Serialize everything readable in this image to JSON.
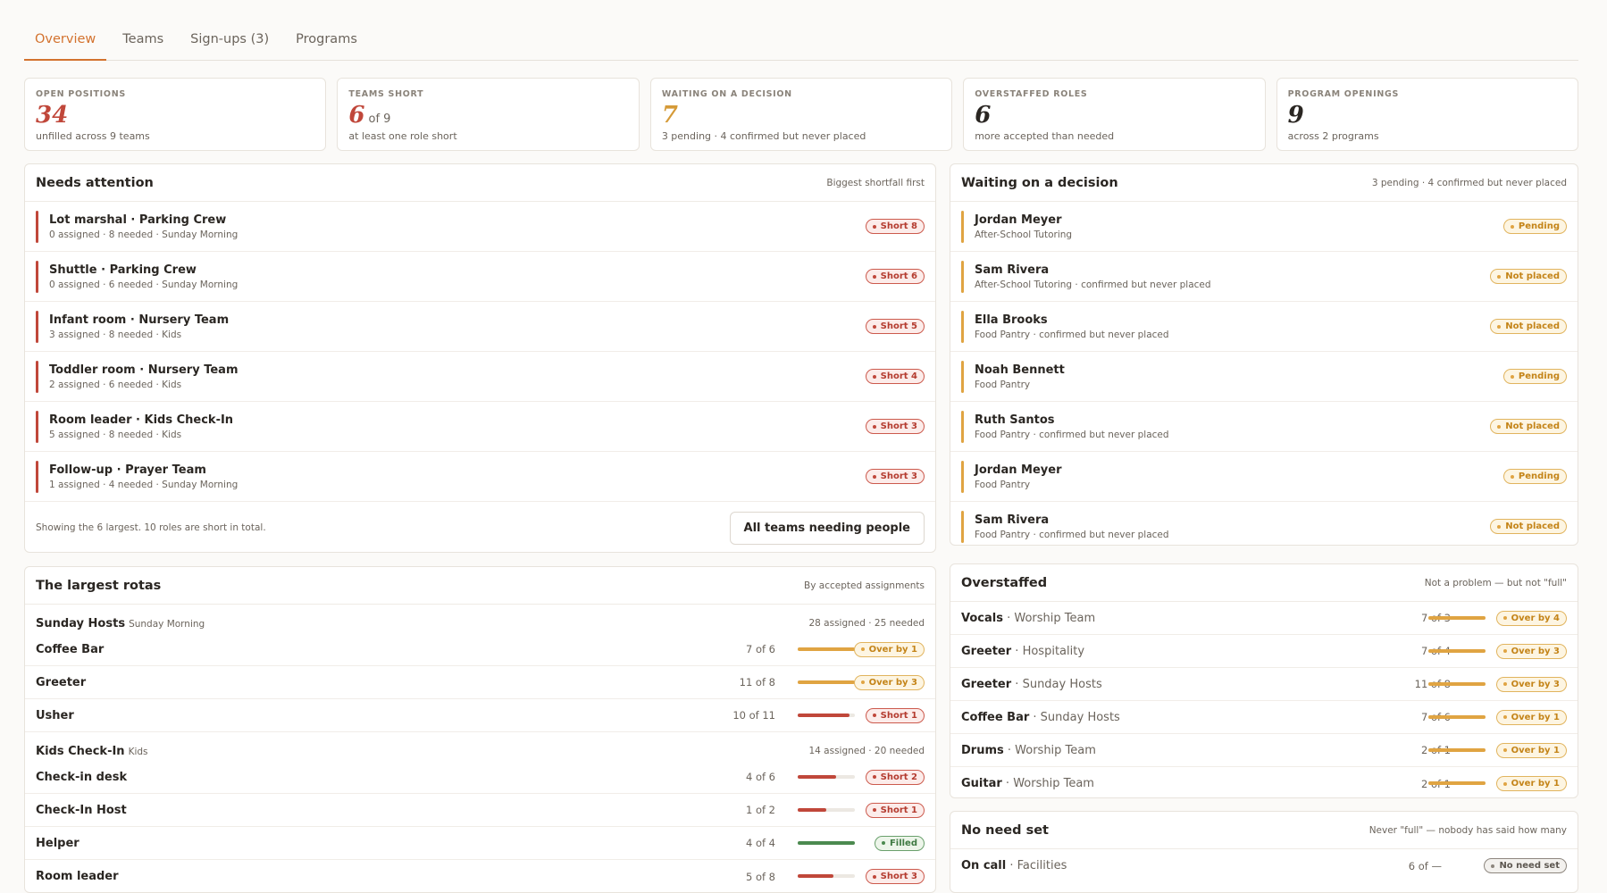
{
  "tabs": [
    {
      "label": "Overview",
      "active": true
    },
    {
      "label": "Teams",
      "active": false
    },
    {
      "label": "Sign-ups (3)",
      "active": false
    },
    {
      "label": "Programs",
      "active": false
    }
  ],
  "stats": [
    {
      "label": "OPEN POSITIONS",
      "value": "34",
      "suffix": "",
      "sub": "unfilled across 9 teams",
      "color": "#c0473a"
    },
    {
      "label": "TEAMS SHORT",
      "value": "6",
      "suffix": "of 9",
      "sub": "at least one role short",
      "color": "#c0473a"
    },
    {
      "label": "WAITING ON A DECISION",
      "value": "7",
      "suffix": "",
      "sub": "3 pending · 4 confirmed but never placed",
      "color": "#d59a37"
    },
    {
      "label": "OVERSTAFFED ROLES",
      "value": "6",
      "suffix": "",
      "sub": "more accepted than needed",
      "color": "#2a2622"
    },
    {
      "label": "PROGRAM OPENINGS",
      "value": "9",
      "suffix": "",
      "sub": "across 2 programs",
      "color": "#2a2622"
    }
  ],
  "attention": {
    "title": "Needs attention",
    "meta": "Biggest shortfall first",
    "rows": [
      {
        "title": "Lot marshal · Parking Crew",
        "sub": "0 assigned · 8 needed · Sunday Morning",
        "pill": "Short 8"
      },
      {
        "title": "Shuttle · Parking Crew",
        "sub": "0 assigned · 6 needed · Sunday Morning",
        "pill": "Short 6"
      },
      {
        "title": "Infant room · Nursery Team",
        "sub": "3 assigned · 8 needed · Kids",
        "pill": "Short 5"
      },
      {
        "title": "Toddler room · Nursery Team",
        "sub": "2 assigned · 6 needed · Kids",
        "pill": "Short 4"
      },
      {
        "title": "Room leader · Kids Check-In",
        "sub": "5 assigned · 8 needed · Kids",
        "pill": "Short 3"
      },
      {
        "title": "Follow-up · Prayer Team",
        "sub": "1 assigned · 4 needed · Sunday Morning",
        "pill": "Short 3"
      }
    ],
    "footer_text": "Showing the 6 largest. 10 roles are short in total.",
    "footer_button": "All teams needing people"
  },
  "waiting": {
    "title": "Waiting on a decision",
    "meta": "3 pending · 4 confirmed but never placed",
    "rows": [
      {
        "name": "Jordan Meyer",
        "sub": "After-School Tutoring",
        "pill": "Pending"
      },
      {
        "name": "Sam Rivera",
        "sub": "After-School Tutoring · confirmed but never placed",
        "pill": "Not placed"
      },
      {
        "name": "Ella Brooks",
        "sub": "Food Pantry · confirmed but never placed",
        "pill": "Not placed"
      },
      {
        "name": "Noah Bennett",
        "sub": "Food Pantry",
        "pill": "Pending"
      },
      {
        "name": "Ruth Santos",
        "sub": "Food Pantry · confirmed but never placed",
        "pill": "Not placed"
      },
      {
        "name": "Jordan Meyer",
        "sub": "Food Pantry",
        "pill": "Pending"
      },
      {
        "name": "Sam Rivera",
        "sub": "Food Pantry · confirmed but never placed",
        "pill": "Not placed"
      }
    ]
  },
  "rotas": {
    "title": "The largest rotas",
    "meta": "By accepted assignments",
    "groups": [
      {
        "name": "Sunday Hosts",
        "sub": "Sunday Morning",
        "meta": "28 assigned · 25 needed",
        "rows": [
          {
            "name": "Coffee Bar",
            "count": "7 of 6",
            "fill": 1.0,
            "status": "amber",
            "pill": "Over by 1"
          },
          {
            "name": "Greeter",
            "count": "11 of 8",
            "fill": 1.0,
            "status": "amber",
            "pill": "Over by 3"
          },
          {
            "name": "Usher",
            "count": "10 of 11",
            "fill": 0.91,
            "status": "red",
            "pill": "Short 1"
          }
        ]
      },
      {
        "name": "Kids Check-In",
        "sub": "Kids",
        "meta": "14 assigned · 20 needed",
        "rows": [
          {
            "name": "Check-in desk",
            "count": "4 of 6",
            "fill": 0.67,
            "status": "red",
            "pill": "Short 2"
          },
          {
            "name": "Check-In Host",
            "count": "1 of 2",
            "fill": 0.5,
            "status": "red",
            "pill": "Short 1"
          },
          {
            "name": "Helper",
            "count": "4 of 4",
            "fill": 1.0,
            "status": "green",
            "pill": "Filled"
          },
          {
            "name": "Room leader",
            "count": "5 of 8",
            "fill": 0.63,
            "status": "red",
            "pill": "Short 3"
          }
        ]
      }
    ]
  },
  "overstaffed": {
    "title": "Overstaffed",
    "meta": "Not a problem — but not \"full\"",
    "rows": [
      {
        "role": "Vocals",
        "team": "Worship Team",
        "count": "7 of 3",
        "fill": 1.0,
        "pill": "Over by 4"
      },
      {
        "role": "Greeter",
        "team": "Hospitality",
        "count": "7 of 4",
        "fill": 1.0,
        "pill": "Over by 3"
      },
      {
        "role": "Greeter",
        "team": "Sunday Hosts",
        "count": "11 of 8",
        "fill": 1.0,
        "pill": "Over by 3"
      },
      {
        "role": "Coffee Bar",
        "team": "Sunday Hosts",
        "count": "7 of 6",
        "fill": 1.0,
        "pill": "Over by 1"
      },
      {
        "role": "Drums",
        "team": "Worship Team",
        "count": "2 of 1",
        "fill": 1.0,
        "pill": "Over by 1"
      },
      {
        "role": "Guitar",
        "team": "Worship Team",
        "count": "2 of 1",
        "fill": 1.0,
        "pill": "Over by 1"
      }
    ]
  },
  "no_need": {
    "title": "No need set",
    "meta": "Never \"full\" — nobody has said how many",
    "rows": [
      {
        "role": "On call",
        "team": "Facilities",
        "count": "6 of —",
        "pill": "No need set"
      }
    ]
  }
}
